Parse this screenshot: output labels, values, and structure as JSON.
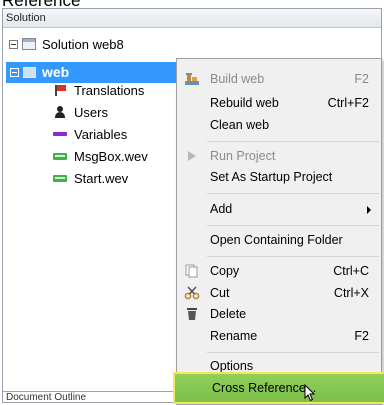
{
  "page_top_text": "Reference",
  "solution_panel": {
    "header": "Solution",
    "tree": {
      "solution_label": "Solution web8",
      "project_label": "web",
      "children": [
        "Translations",
        "Users",
        "Variables",
        "MsgBox.wev",
        "Start.wev"
      ]
    },
    "bottom_tab": "Document Outline"
  },
  "context_menu": {
    "build": {
      "label": "Build web",
      "shortcut": "F2"
    },
    "rebuild": {
      "label": "Rebuild web",
      "shortcut": "Ctrl+F2"
    },
    "clean": {
      "label": "Clean web"
    },
    "run": {
      "label": "Run Project"
    },
    "startup": {
      "label": "Set As Startup Project"
    },
    "add": {
      "label": "Add"
    },
    "open_folder": {
      "label": "Open Containing Folder"
    },
    "copy": {
      "label": "Copy",
      "shortcut": "Ctrl+C"
    },
    "cut": {
      "label": "Cut",
      "shortcut": "Ctrl+X"
    },
    "delete": {
      "label": "Delete"
    },
    "rename": {
      "label": "Rename",
      "shortcut": "F2"
    },
    "options": {
      "label": "Options"
    },
    "cross_reference": {
      "label": "Cross Reference..."
    }
  },
  "colors": {
    "selection": "#3399ff",
    "highlight": "#8fcf5a",
    "highlight_border": "#f3e85a"
  }
}
